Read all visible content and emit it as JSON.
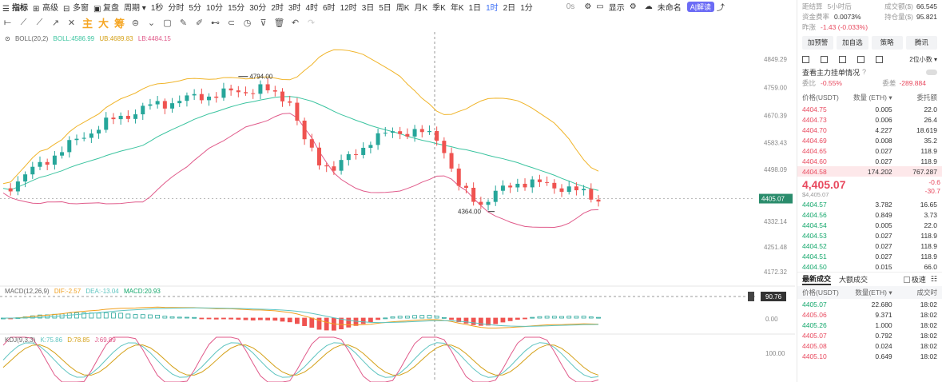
{
  "topbar": {
    "items": [
      "指标",
      "高级",
      "多窗",
      "复盘",
      "周期",
      "1秒",
      "分时",
      "5分",
      "10分",
      "15分",
      "30分",
      "2时",
      "3时",
      "4时",
      "6时",
      "12时",
      "3日",
      "5日",
      "周K",
      "月K",
      "季K",
      "年K",
      "1日",
      "1时",
      "2日",
      "1分"
    ],
    "active": "1时",
    "indicator_chars": [
      "主",
      "大",
      "筹"
    ],
    "right_items": [
      "0s",
      "显示",
      "未命名"
    ],
    "ai_badge": "A|解读"
  },
  "chart": {
    "boll_label": "BOLL(20,2)",
    "boll_mid": "BOLL:4586.99",
    "boll_ub": "UB:4689.83",
    "boll_lb": "LB:4484.15",
    "price_axis": [
      "4849.29",
      "4759.00",
      "4670.39",
      "4583.43",
      "4498.09",
      "4405.07",
      "4332.14",
      "4251.48",
      "4172.32"
    ],
    "high_marker": "4794.00",
    "low_marker": "4364.00",
    "current_tag": "4405.07",
    "macd_label": "MACD(12,26,9)",
    "macd_dif": "DIF:-2.57",
    "macd_dea": "DEA:-13.04",
    "macd_val": "MACD:20.93",
    "macd_tag": "90.76",
    "macd_axis": "0.00",
    "kdj_label": "KDJ(9,3,3)",
    "kdj_k": "K:75.86",
    "kdj_d": "D:78.85",
    "kdj_j": "J:69.89",
    "kdj_axis": "100.00",
    "colors": {
      "up": "#26a69a",
      "down": "#ef5350",
      "boll_upper": "#f0b429",
      "boll_mid": "#3cc4a0",
      "boll_lower": "#e05a8a",
      "macd_dif": "#f0a020",
      "macd_dea": "#5ec4c0"
    }
  },
  "panel": {
    "settle": {
      "label": "距结算",
      "value": "5小时后",
      "label2": "成交额($)",
      "value2": "66.545"
    },
    "funding": {
      "label": "资金费率",
      "value": "0.0073%",
      "label2": "持仓量($)",
      "value2": "95.821"
    },
    "change": {
      "label": "昨涨",
      "value": "-1.43 (-0.033%)"
    },
    "buttons": [
      "加预警",
      "加自选",
      "策略",
      "腾讯"
    ],
    "precision": "2位小数",
    "main_orders": "查看主力挂单情况",
    "ratio": {
      "label": "委比",
      "value": "-0.55%",
      "label2": "委差",
      "value2": "-289.884"
    },
    "ob_headers": [
      "价格(USDT)",
      "数量 (ETH)",
      "委托额"
    ],
    "asks": [
      [
        "4404.75",
        "0.005",
        "22.0"
      ],
      [
        "4404.73",
        "0.006",
        "26.4"
      ],
      [
        "4404.70",
        "4.227",
        "18.619"
      ],
      [
        "4404.69",
        "0.008",
        "35.2"
      ],
      [
        "4404.65",
        "0.027",
        "118.9"
      ],
      [
        "4404.60",
        "0.027",
        "118.9"
      ],
      [
        "4404.58",
        "174.202",
        "767.287"
      ]
    ],
    "last_price": "4,405.07",
    "last_sub": "$4,405.07",
    "last_change_pct": "-0.6",
    "last_change_abs": "-30.7",
    "bids": [
      [
        "4404.57",
        "3.782",
        "16.65"
      ],
      [
        "4404.56",
        "0.849",
        "3.73"
      ],
      [
        "4404.54",
        "0.005",
        "22.0"
      ],
      [
        "4404.53",
        "0.027",
        "118.9"
      ],
      [
        "4404.52",
        "0.027",
        "118.9"
      ],
      [
        "4404.51",
        "0.027",
        "118.9"
      ],
      [
        "4404.50",
        "0.015",
        "66.0"
      ]
    ],
    "trade_tabs": [
      "最新成交",
      "大额成交",
      "极速"
    ],
    "trade_headers": [
      "价格(USDT)",
      "数量(ETH)",
      "成交时"
    ],
    "trades": [
      [
        "4405.07",
        "22.680",
        "18:02"
      ],
      [
        "4405.06",
        "9.371",
        "18:02"
      ],
      [
        "4405.26",
        "1.000",
        "18:02"
      ],
      [
        "4405.07",
        "0.792",
        "18:02"
      ],
      [
        "4405.08",
        "0.024",
        "18:02"
      ],
      [
        "4405.10",
        "0.649",
        "18:02"
      ]
    ],
    "trade_side": [
      "up",
      "down",
      "up",
      "down",
      "down",
      "down"
    ]
  }
}
